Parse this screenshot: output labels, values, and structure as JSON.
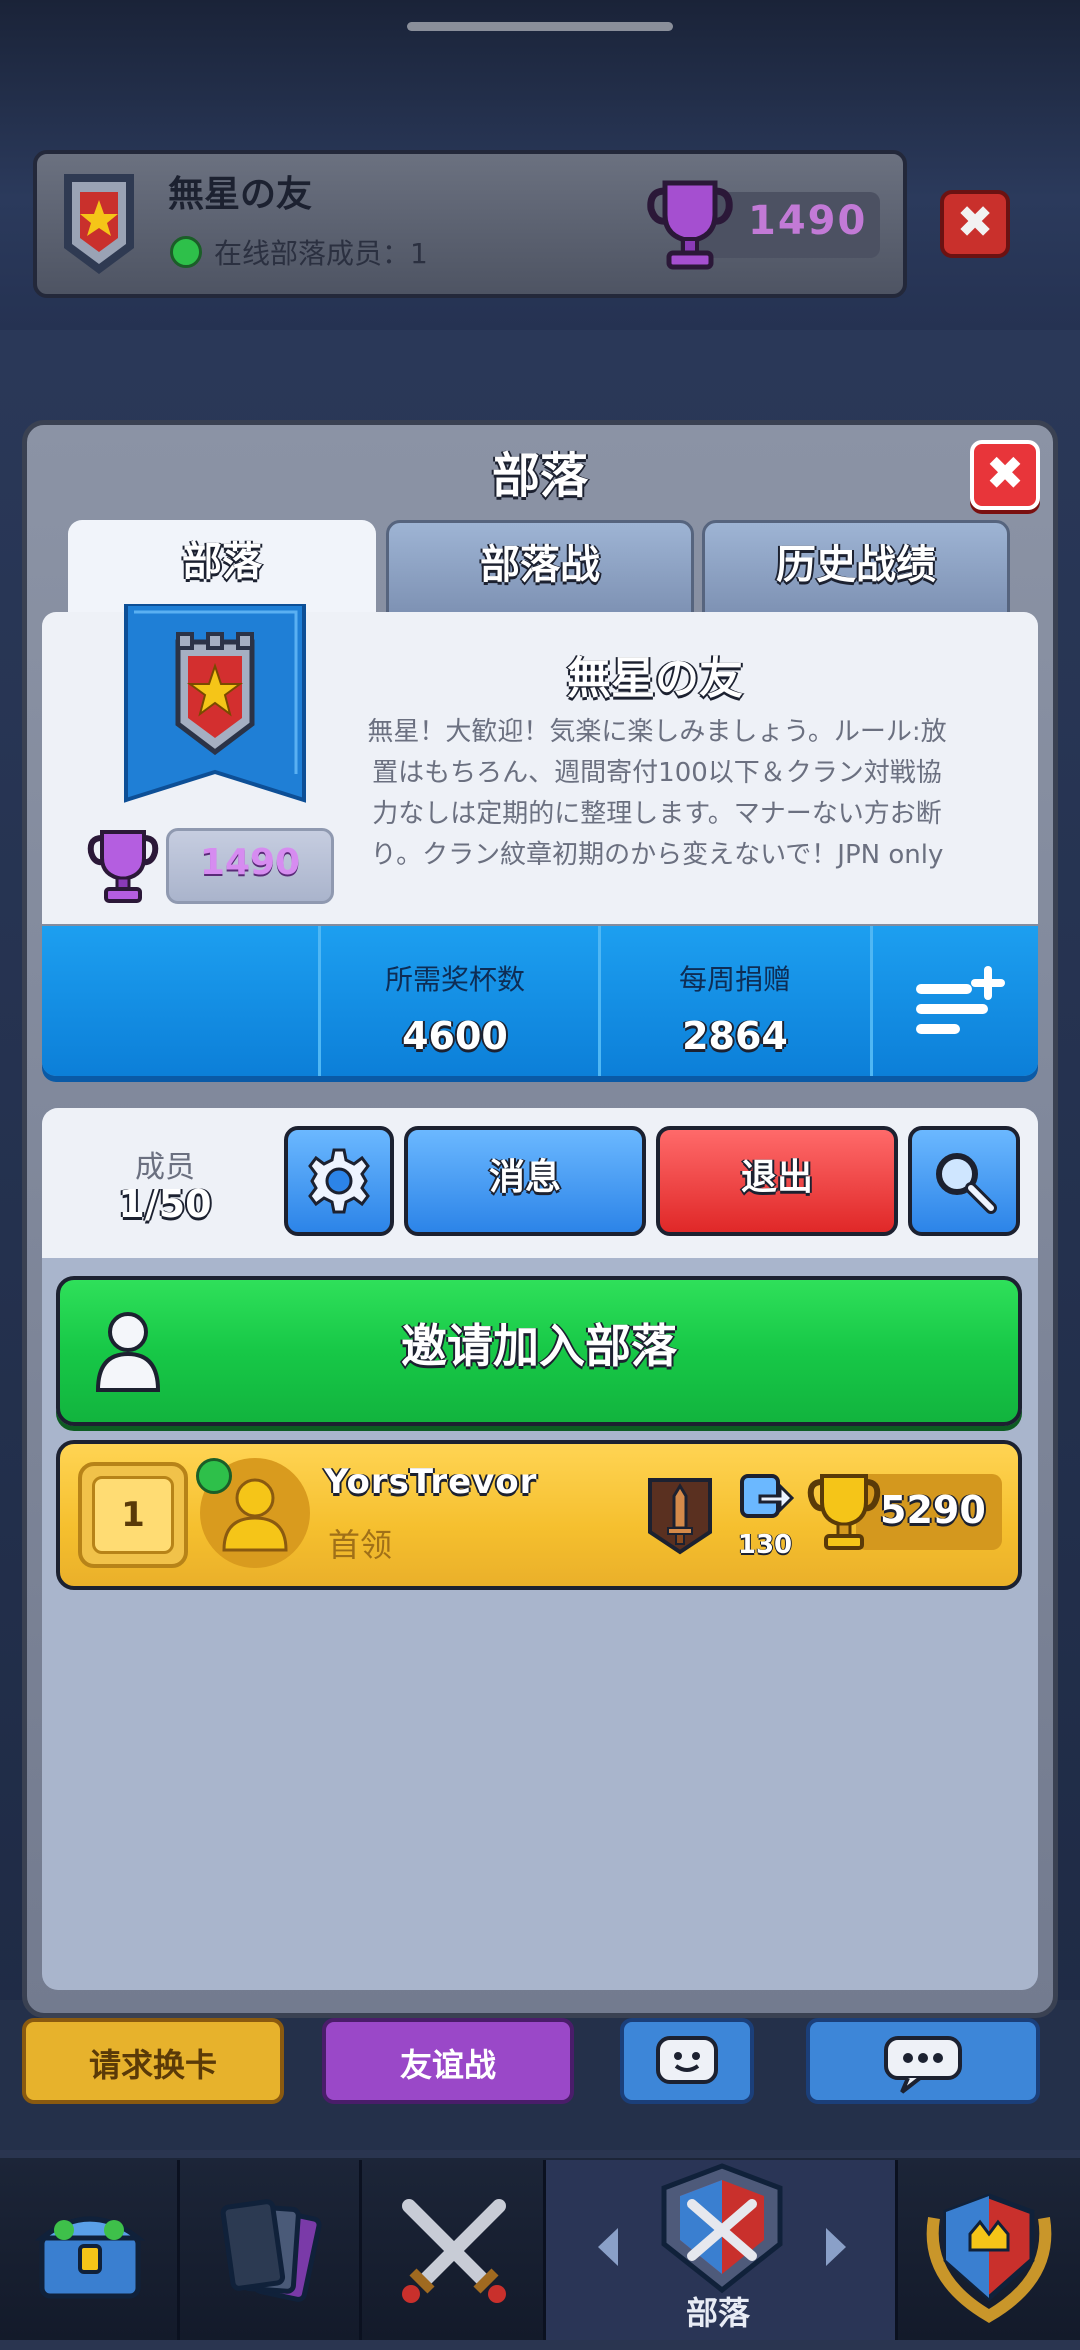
{
  "top_card": {
    "clan_name": "無星の友",
    "online_text": "在线部落成员：1",
    "trophies": "1490",
    "close_label": "✖"
  },
  "bottom_actions": {
    "request": "请求换卡",
    "friendly": "友谊战"
  },
  "modal": {
    "title": "部落",
    "close_label": "✖",
    "tabs": [
      "部落",
      "部落战",
      "历史战绩"
    ],
    "clan": {
      "name": "無星の友",
      "description": "無星！大歓迎！気楽に楽しみましょう。ルール:放置はもちろん、週間寄付100以下＆クラン対戦協力なしは定期的に整理します。マナーない方お断り。クラン紋章初期のから変えないで！JPN only",
      "badge_trophies": "1490"
    },
    "stats": [
      {
        "label": "所需奖杯数",
        "value": "4600"
      },
      {
        "label": "每周捐赠",
        "value": "2864"
      }
    ],
    "members": {
      "label": "成员",
      "count": "1/50",
      "message_button": "消息",
      "leave_button": "退出",
      "invite_button": "邀请加入部落",
      "list": [
        {
          "rank": "1",
          "name": "YorsTrevor",
          "role": "首领",
          "donations": "130",
          "trophies": "5290"
        }
      ]
    }
  },
  "nav": {
    "active_label": "部落"
  },
  "icons": [
    "clan-badge-icon",
    "trophy-icon",
    "close-icon",
    "gear-icon",
    "search-icon",
    "person-icon",
    "filter-add-icon",
    "cards-donate-icon",
    "arena-icon",
    "chest-icon",
    "cards-icon",
    "swords-icon",
    "emote-icon",
    "chat-icon"
  ],
  "colors": {
    "stats_blue": "#1d9ff0",
    "invite_green": "#17c847",
    "leave_red": "#e02828",
    "member_gold": "#f5bf2e"
  }
}
